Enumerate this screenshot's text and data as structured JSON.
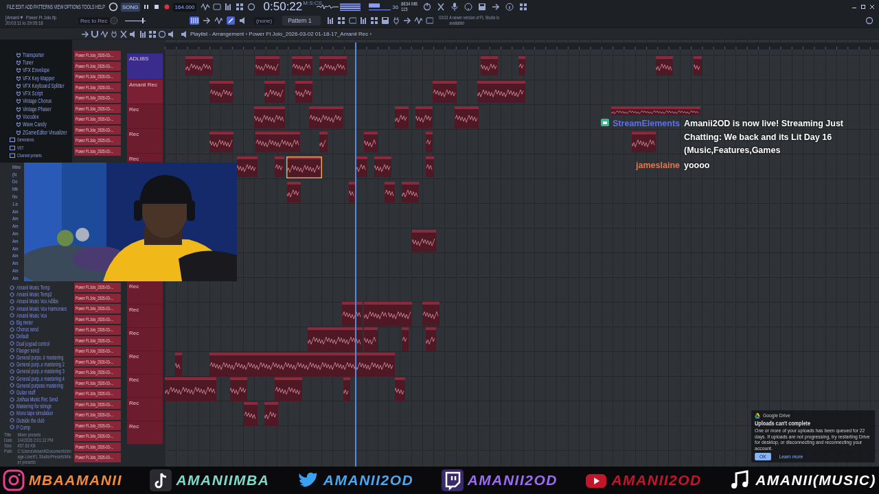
{
  "menu": [
    "FILE",
    "EDIT",
    "ADD",
    "PATTERNS",
    "VIEW",
    "OPTIONS",
    "TOOLS",
    "HELP"
  ],
  "project": {
    "user": "[Amanii ♥",
    "file": "Power Ft Jolo.flp",
    "time_range": "20:03:11 to 29:05:18",
    "rec_label": "Rec to Rec"
  },
  "master_volume": {
    "level": 0.9
  },
  "transport": {
    "mode": "SONG",
    "tempo": "164.000",
    "time": "0:50:22",
    "time_unit": "M:S:CS"
  },
  "memory": {
    "cpu": "36",
    "ram": "8834 MB",
    "polyphony": "115"
  },
  "pattern": {
    "snap": "(none)",
    "name": "Pattern 1"
  },
  "hint": {
    "counter": "03:03",
    "text": "A newer version of FL Studio is available!"
  },
  "breadcrumb": "Playlist - Arrangement › Power Ft Jolo_2026-03-02 01-18-17_Amanii Rec ›",
  "browser": {
    "top_items": [
      {
        "label": "Transporter",
        "kind": "plugin"
      },
      {
        "label": "Tuner",
        "kind": "plugin"
      },
      {
        "label": "VFX Envelope",
        "kind": "plugin"
      },
      {
        "label": "VFX Key Mapper",
        "kind": "plugin"
      },
      {
        "label": "VFX Keyboard Splitter",
        "kind": "plugin"
      },
      {
        "label": "VFX Script",
        "kind": "plugin"
      },
      {
        "label": "Vintage Chorus",
        "kind": "plugin"
      },
      {
        "label": "Vintage Phaser",
        "kind": "plugin"
      },
      {
        "label": "Vocodex",
        "kind": "plugin"
      },
      {
        "label": "Wave Candy",
        "kind": "plugin"
      },
      {
        "label": "ZGameEditor Visualizer",
        "kind": "plugin"
      },
      {
        "label": "Generators",
        "kind": "folder"
      },
      {
        "label": "VST",
        "kind": "folder"
      },
      {
        "label": "Channel presets",
        "kind": "folder"
      }
    ],
    "partial_items": [
      "Mixe",
      "(N",
      "Do",
      "Mb",
      "Nu",
      "1-b",
      "Am",
      "Am",
      "Am",
      "Am",
      "Am",
      "Am",
      "Am",
      "Am",
      "Am",
      "Am"
    ],
    "bottom_items": [
      "Amanii Music Temp",
      "Amanii Music Temp2",
      "Amanii Music Vox Adlibs",
      "Amanii Music Vox Harmonies",
      "Amanii Music Vox",
      "Big meter",
      "Chorus send",
      "Default",
      "Dual joypad control",
      "Flanger send",
      "General purpo..ir mastering",
      "General purp..e mastering 2",
      "General purp..e mastering 3",
      "General purp..e mastering 4",
      "General purpose mastering",
      "Guitar stuff",
      "Joshua Music Rec Send",
      "Mastering for strings",
      "Mono tape simulation",
      "Outside the club",
      "P Comp"
    ],
    "info": [
      {
        "label": "Title",
        "value": "Mixer presets"
      },
      {
        "label": "Date",
        "value": "1/4/2026 2:01:12 PM"
      },
      {
        "label": "Size",
        "value": "457.63 KB"
      },
      {
        "label": "Path",
        "value": "C:\\Users\\Amanii\\Documents\\Image-Line\\FL Studio\\Presets\\Mixer presets\\"
      }
    ]
  },
  "clips": {
    "top": [
      "Power Ft.Jolo_2026-03-...",
      "Power Ft.Jolo_2026-03-...",
      "Power Ft.Jolo_2026-03-...",
      "Power Ft.Jolo_2026-03-...",
      "Power Ft.Jolo_2026-03-...",
      "Power Ft.Jolo_2026-03-...",
      "Power Ft.Jolo_2026-03-...",
      "Power Ft.Jolo_2026-03-...",
      "Power Ft.Jolo_2026-03-...",
      "Power Ft.Jolo_2026-03-..."
    ],
    "bottom": [
      "Power Ft.Jolo_2026-03-...",
      "Power Ft.Jolo_2026-03-...",
      "Power Ft.Jolo_2026-03-...",
      "Power Ft.Jolo_2026-03-...",
      "Power Ft.Jolo_2026-03-...",
      "Power Ft.Jolo_2026-03-...",
      "Power Ft.Jolo_2026-03-...",
      "Power Ft.Jolo_2026-03-...",
      "Power Ft.Jolo_2026-03-...",
      "Power Ft.Jolo_2026-03-...",
      "Power Ft.Jolo_2026-03-...",
      "Power Ft.Jolo_2026-03-...",
      "Power Ft.Jolo_2026-03-...",
      "Power Ft.Jolo_2026-03-...",
      "Power Ft.Jolo_2026-03-...",
      "Power Ft.Jolo_2026-03-...",
      "Power Ft.Jolo_2026-03-..."
    ]
  },
  "tracks_top": [
    {
      "label": "ADLIBS",
      "color": "#3a2c8c"
    },
    {
      "label": "Amanii Rec",
      "color": "#7a1f34"
    },
    {
      "label": "Rec",
      "color": "#6b1d2e"
    },
    {
      "label": "Rec",
      "color": "#6b1d2e"
    },
    {
      "label": "Rec",
      "color": "#6b1d2e"
    }
  ],
  "tracks_bottom": [
    "Rec",
    "Rec",
    "Rec",
    "Rec",
    "Rec",
    "Rec",
    "Rec"
  ],
  "webcam": {
    "kind": "picture"
  },
  "chat": [
    {
      "user": "StreamElements",
      "kind": "bot",
      "color": "#5b6ff0",
      "text": "Amanii2OD is now live! Streaming Just Chatting: We back and its Lit Day 16 (Music,Features,Games"
    },
    {
      "user": "jameslaine",
      "kind": "viewer",
      "color": "#e8744c",
      "text": "yoooo"
    }
  ],
  "notification": {
    "app": "Google Drive",
    "title": "Uploads can't complete",
    "body": "One or more of your uploads has been queued for 22 days. If uploads are not progressing, try restarting Drive for desktop, or disconnecting and reconnecting your account.",
    "ok": "OK",
    "link": "Learn more"
  },
  "socials": [
    {
      "kind": "instagram",
      "handle": "MBAAMANII",
      "color": "#f08a3c"
    },
    {
      "kind": "tiktok",
      "handle": "AMANIIMBA",
      "color": "#7fd8c8"
    },
    {
      "kind": "twitter",
      "handle": "AMANII2OD",
      "color": "#4aa8f0"
    },
    {
      "kind": "twitch",
      "handle": "AMANII2OD",
      "color": "#9b6cf2"
    },
    {
      "kind": "youtube",
      "handle": "AMANII2OD",
      "color": "#c0182a"
    },
    {
      "kind": "music",
      "handle": "AMANII(MUSIC)",
      "color": "#ffffff"
    }
  ]
}
